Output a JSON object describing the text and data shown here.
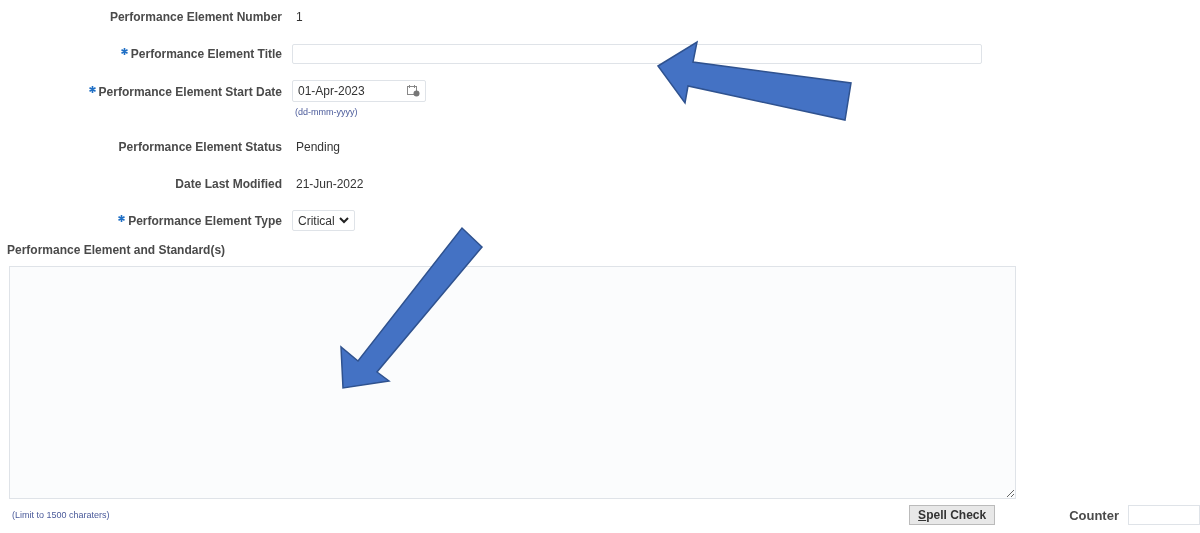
{
  "fields": [
    {
      "kind": "text",
      "label": "Performance Element Number",
      "required": false,
      "value": "1"
    },
    {
      "kind": "input",
      "label": "Performance Element Title",
      "required": true
    },
    {
      "kind": "date",
      "label": "Performance Element Start Date",
      "required": true,
      "value": "01-Apr-2023",
      "hint": "(dd-mmm-yyyy)"
    },
    {
      "kind": "text",
      "label": "Performance Element Status",
      "required": false,
      "value": "Pending"
    },
    {
      "kind": "text",
      "label": "Date Last Modified",
      "required": false,
      "value": "21-Jun-2022"
    },
    {
      "kind": "select",
      "label": "Performance Element Type",
      "required": true,
      "value": "Critical"
    }
  ],
  "standards": {
    "label": "Performance Element and Standard(s)",
    "limit_note": "(Limit to 1500 charaters)"
  },
  "spell_check_button": {
    "label": "Spell Check",
    "mnemonic": true
  },
  "counter": {
    "label": "Counter"
  },
  "annotations": [
    {
      "kind": "arrow-left"
    },
    {
      "kind": "arrow-down-left"
    }
  ]
}
